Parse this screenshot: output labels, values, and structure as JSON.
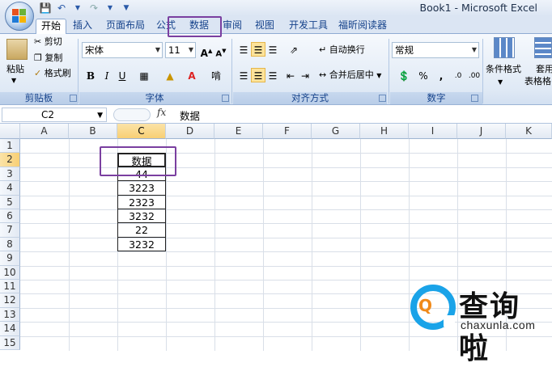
{
  "app_title": "Book1 - Microsoft Excel",
  "tabs": [
    "开始",
    "插入",
    "页面布局",
    "公式",
    "数据",
    "审阅",
    "视图",
    "开发工具",
    "福昕阅读器"
  ],
  "active_tab": "开始",
  "ribbon": {
    "clipboard": {
      "paste": "粘贴",
      "cut": "剪切",
      "copy": "复制",
      "format_painter": "格式刷",
      "label": "剪贴板"
    },
    "font": {
      "font_name": "宋体",
      "font_size": "11",
      "grow": "A",
      "shrink": "A",
      "bold": "B",
      "italic": "I",
      "underline": "U",
      "label": "字体"
    },
    "alignment": {
      "wrap": "自动换行",
      "merge": "合并后居中",
      "label": "对齐方式"
    },
    "number": {
      "format": "常规",
      "percent": "%",
      "comma": ",",
      "label": "数字"
    },
    "styles": {
      "cond_format": "条件格式",
      "table_format_1": "套用",
      "table_format_2": "表格格"
    }
  },
  "formula_bar": {
    "name_box": "C2",
    "fx": "fx",
    "value": "数据"
  },
  "columns": [
    "A",
    "B",
    "C",
    "D",
    "E",
    "F",
    "G",
    "H",
    "I",
    "J",
    "K"
  ],
  "rows": [
    "1",
    "2",
    "3",
    "4",
    "5",
    "6",
    "7",
    "8",
    "9",
    "10",
    "11",
    "12",
    "13",
    "14",
    "15"
  ],
  "selected_cell": "C2",
  "column_c_values": [
    "数据",
    "44",
    "3223",
    "2323",
    "3232",
    "22",
    "3232"
  ],
  "watermark": {
    "text": "查询啦",
    "domain": "chaxunla.com",
    "glyph": "Q"
  },
  "colors": {
    "highlight": "#7a3fa0",
    "accent": "#1aa3e8",
    "watermark_q": "#f08a1a"
  }
}
